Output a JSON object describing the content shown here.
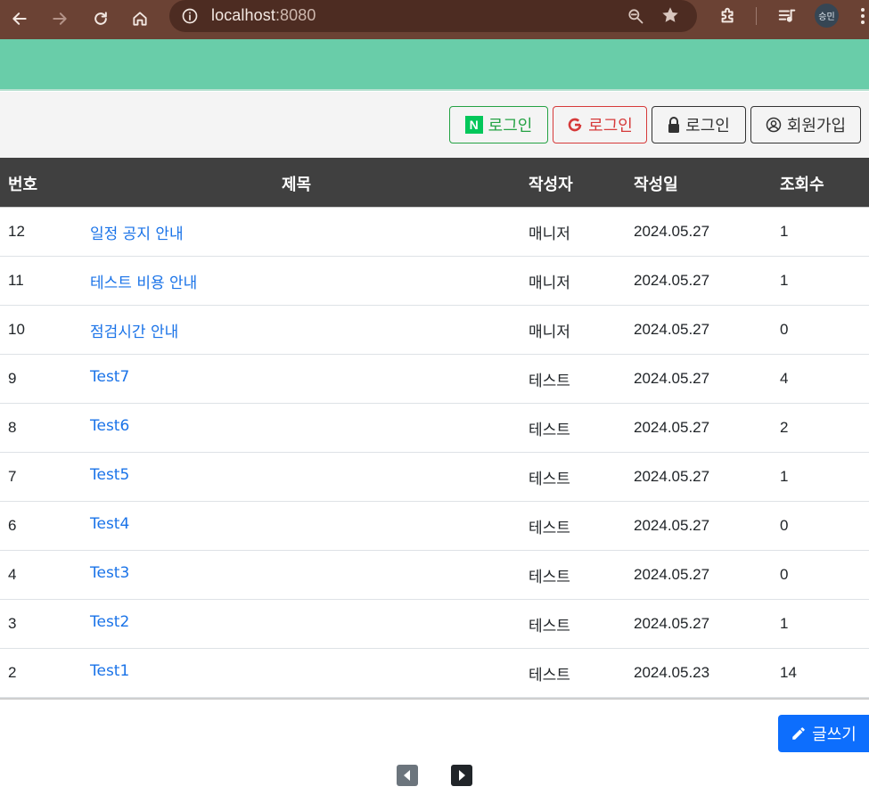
{
  "browser": {
    "url_host": "localhost",
    "url_port": ":8080",
    "profile_label": "승민"
  },
  "auth": {
    "naver_label": "로그인",
    "naver_logo": "N",
    "google_label": "로그인",
    "login_label": "로그인",
    "join_label": "회원가입"
  },
  "table": {
    "headers": {
      "no": "번호",
      "title": "제목",
      "author": "작성자",
      "date": "작성일",
      "views": "조회수"
    },
    "rows": [
      {
        "no": "12",
        "title": "일정 공지 안내",
        "author": "매니저",
        "date": "2024.05.27",
        "views": "1"
      },
      {
        "no": "11",
        "title": "테스트 비용 안내",
        "author": "매니저",
        "date": "2024.05.27",
        "views": "1"
      },
      {
        "no": "10",
        "title": "점검시간 안내",
        "author": "매니저",
        "date": "2024.05.27",
        "views": "0"
      },
      {
        "no": "9",
        "title": "Test7",
        "author": "테스트",
        "date": "2024.05.27",
        "views": "4"
      },
      {
        "no": "8",
        "title": "Test6",
        "author": "테스트",
        "date": "2024.05.27",
        "views": "2"
      },
      {
        "no": "7",
        "title": "Test5",
        "author": "테스트",
        "date": "2024.05.27",
        "views": "1"
      },
      {
        "no": "6",
        "title": "Test4",
        "author": "테스트",
        "date": "2024.05.27",
        "views": "0"
      },
      {
        "no": "4",
        "title": "Test3",
        "author": "테스트",
        "date": "2024.05.27",
        "views": "0"
      },
      {
        "no": "3",
        "title": "Test2",
        "author": "테스트",
        "date": "2024.05.27",
        "views": "1"
      },
      {
        "no": "2",
        "title": "Test1",
        "author": "테스트",
        "date": "2024.05.23",
        "views": "14"
      }
    ]
  },
  "write_label": "글쓰기",
  "colors": {
    "chrome": "#6b4234",
    "banner": "#69cda9",
    "link": "#1a73e8",
    "header": "#404040",
    "primary": "#0d6efd"
  },
  "icons": [
    "back-icon",
    "forward-icon",
    "reload-icon",
    "home-icon",
    "info-icon",
    "zoom-icon",
    "star-icon",
    "extensions-icon",
    "media-icon",
    "menu-icon",
    "naver-icon",
    "google-icon",
    "lock-icon",
    "user-circle-icon",
    "pencil-icon",
    "prev-icon",
    "next-icon"
  ]
}
